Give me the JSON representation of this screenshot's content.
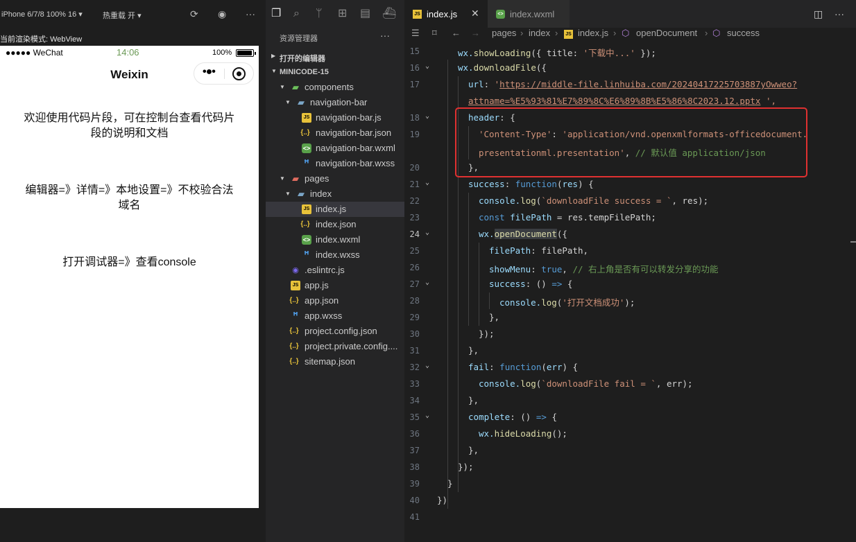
{
  "simulator": {
    "device": "iPhone 6/7/8 100% 16 ▾",
    "hot_reload": "热重载 开 ▾",
    "render_mode": "当前渲染模式: WebView",
    "status_left": "●●●●● WeChat",
    "status_time": "14:06",
    "status_battery": "100%",
    "nav_title": "Weixin",
    "paragraphs": [
      "欢迎使用代码片段，可在控制台查看代码片段的说明和文档",
      "编辑器=》详情=》本地设置=》不校验合法域名",
      "打开调试器=》查看console"
    ]
  },
  "explorer": {
    "title": "资源管理器",
    "more": "···",
    "open_editors": "打开的编辑器",
    "project": "MINICODE-15",
    "tree": [
      {
        "label": "components",
        "icon": "folder-green"
      },
      {
        "label": "navigation-bar",
        "icon": "folder"
      },
      {
        "label": "navigation-bar.js",
        "icon": "js"
      },
      {
        "label": "navigation-bar.json",
        "icon": "json"
      },
      {
        "label": "navigation-bar.wxml",
        "icon": "wxml"
      },
      {
        "label": "navigation-bar.wxss",
        "icon": "wxss"
      },
      {
        "label": "pages",
        "icon": "folder-red"
      },
      {
        "label": "index",
        "icon": "folder"
      },
      {
        "label": "index.js",
        "icon": "js"
      },
      {
        "label": "index.json",
        "icon": "json"
      },
      {
        "label": "index.wxml",
        "icon": "wxml"
      },
      {
        "label": "index.wxss",
        "icon": "wxss"
      },
      {
        "label": ".eslintrc.js",
        "icon": "eslint"
      },
      {
        "label": "app.js",
        "icon": "js"
      },
      {
        "label": "app.json",
        "icon": "json"
      },
      {
        "label": "app.wxss",
        "icon": "wxss"
      },
      {
        "label": "project.config.json",
        "icon": "json"
      },
      {
        "label": "project.private.config....",
        "icon": "json"
      },
      {
        "label": "sitemap.json",
        "icon": "json"
      }
    ]
  },
  "editor": {
    "tabs": [
      {
        "label": "index.js",
        "active": true
      },
      {
        "label": "index.wxml",
        "active": false
      }
    ],
    "breadcrumb": [
      "pages",
      "index",
      "index.js",
      "openDocument",
      "success"
    ],
    "line_numbers": [
      "15",
      "16",
      "17",
      "",
      "18",
      "19",
      "",
      "20",
      "21",
      "22",
      "23",
      "24",
      "25",
      "26",
      "27",
      "28",
      "29",
      "30",
      "31",
      "32",
      "33",
      "34",
      "35",
      "36",
      "37",
      "38",
      "39",
      "40",
      "41"
    ],
    "current_line": "24",
    "code": {
      "l15a": "wx.",
      "l15b": "showLoading",
      "l15c": "({ title: ",
      "l15d": "'下载中...'",
      "l15e": " });",
      "l16a": "wx.",
      "l16b": "downloadFile",
      "l16c": "({",
      "l17a": "url",
      "l17b": ": ",
      "l17c": "'",
      "l17d": "https://middle-file.linhuiba.com/20240417225703887yOwweo?",
      "l17e": "attname=%E5%93%81%E7%89%8C%E6%89%8B%E5%86%8C2023.12.pptx",
      "l17f": " ',",
      "l18a": "header",
      "l18b": ": {",
      "l19a": "'Content-Type'",
      "l19b": ": ",
      "l19c": "'application/vnd.openxmlformats-officedocument.",
      "l19d": "presentationml.presentation'",
      "l19e": ", ",
      "l19f": "// 默认值 application/json",
      "l20": "},",
      "l21a": "success",
      "l21b": ": ",
      "l21c": "function",
      "l21d": "(",
      "l21e": "res",
      "l21f": ") {",
      "l22a": "console.",
      "l22b": "log",
      "l22c": "(",
      "l22d": "`downloadFile success = `",
      "l22e": ", res);",
      "l23a": "const",
      "l23b": " filePath",
      "l23c": " = res.tempFilePath;",
      "l24a": "wx.",
      "l24b": "openDocument",
      "l24c": "({",
      "l25a": "filePath",
      "l25b": ": filePath,",
      "l26a": "showMenu",
      "l26b": ": ",
      "l26c": "true",
      "l26d": ", ",
      "l26e": "// 右上角是否有可以转发分享的功能",
      "l27a": "success",
      "l27b": ": () ",
      "l27c": "=>",
      "l27d": " {",
      "l28a": "console.",
      "l28b": "log",
      "l28c": "(",
      "l28d": "'打开文档成功'",
      "l28e": ");",
      "l29": "},",
      "l30": "});",
      "l31": "},",
      "l32a": "fail",
      "l32b": ": ",
      "l32c": "function",
      "l32d": "(",
      "l32e": "err",
      "l32f": ") {",
      "l33a": "console.",
      "l33b": "log",
      "l33c": "(",
      "l33d": "`downloadFile fail = `",
      "l33e": ", err);",
      "l34": "},",
      "l35a": "complete",
      "l35b": ": () ",
      "l35c": "=>",
      "l35d": " {",
      "l36a": "wx.",
      "l36b": "hideLoading",
      "l36c": "();",
      "l37": "},",
      "l38": "});",
      "l39": "}",
      "l40": "})"
    }
  },
  "colors": {
    "editor_bg": "#1e1e1e",
    "sidebar_bg": "#252526",
    "highlight_box": "#e03131",
    "string": "#ce9178",
    "keyword": "#569cd6",
    "function": "#dcdcaa",
    "comment": "#6a9955"
  }
}
